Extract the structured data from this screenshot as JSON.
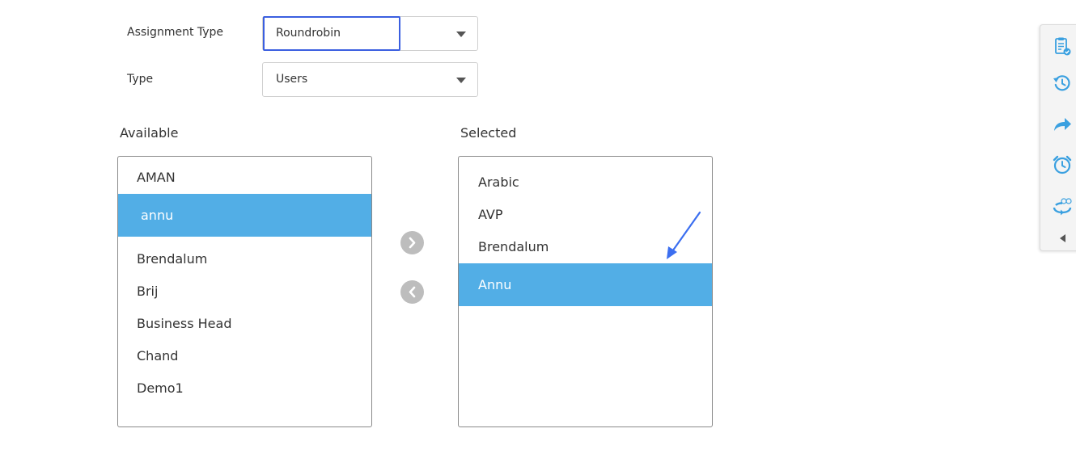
{
  "form": {
    "assignment_type": {
      "label": "Assignment Type",
      "value": "Roundrobin"
    },
    "type": {
      "label": "Type",
      "value": "Users"
    }
  },
  "available": {
    "title": "Available",
    "items": [
      "AMAN",
      "annu",
      "Brendalum",
      "Brij",
      "Business Head",
      "Chand",
      "Demo1"
    ],
    "active_item": "annu"
  },
  "selected": {
    "title": "Selected",
    "items": [
      "Arabic",
      "AVP",
      "Brendalum",
      "Annu"
    ],
    "active_item": "Annu"
  },
  "toolbar": {
    "icons": [
      "clipboard-check-icon",
      "history-icon",
      "share-forward-icon",
      "alarm-clock-icon",
      "360-view-icon",
      "collapse-left-icon"
    ],
    "icon_color": "#3aa0e0"
  },
  "colors": {
    "active_row": "#52aee6",
    "highlight_border": "#3b5fe0",
    "move_button": "#bdbdbd"
  }
}
